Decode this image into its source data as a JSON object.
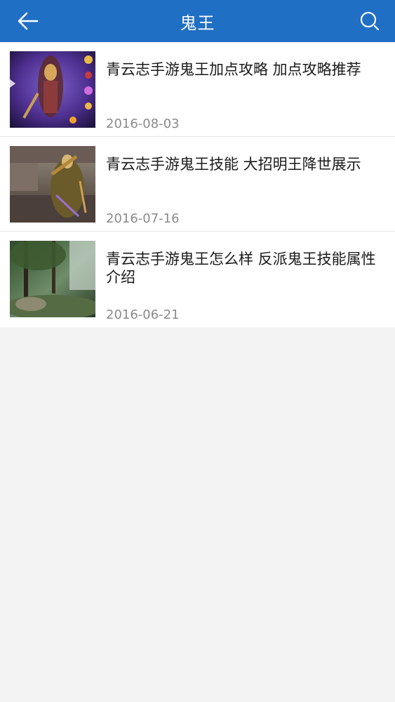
{
  "header": {
    "title": "鬼王",
    "accent_color": "#1f6fc4",
    "back_icon": "arrow-left-icon",
    "search_icon": "search-icon"
  },
  "articles": [
    {
      "title": "青云志手游鬼王加点攻略 加点攻略推荐",
      "date": "2016-08-03",
      "thumbnail": "character-purple-art"
    },
    {
      "title": "青云志手游鬼王技能 大招明王降世展示",
      "date": "2016-07-16",
      "thumbnail": "character-golden-art"
    },
    {
      "title": "青云志手游鬼王怎么样 反派鬼王技能属性介绍",
      "date": "2016-06-21",
      "thumbnail": "forest-scene-art"
    }
  ]
}
